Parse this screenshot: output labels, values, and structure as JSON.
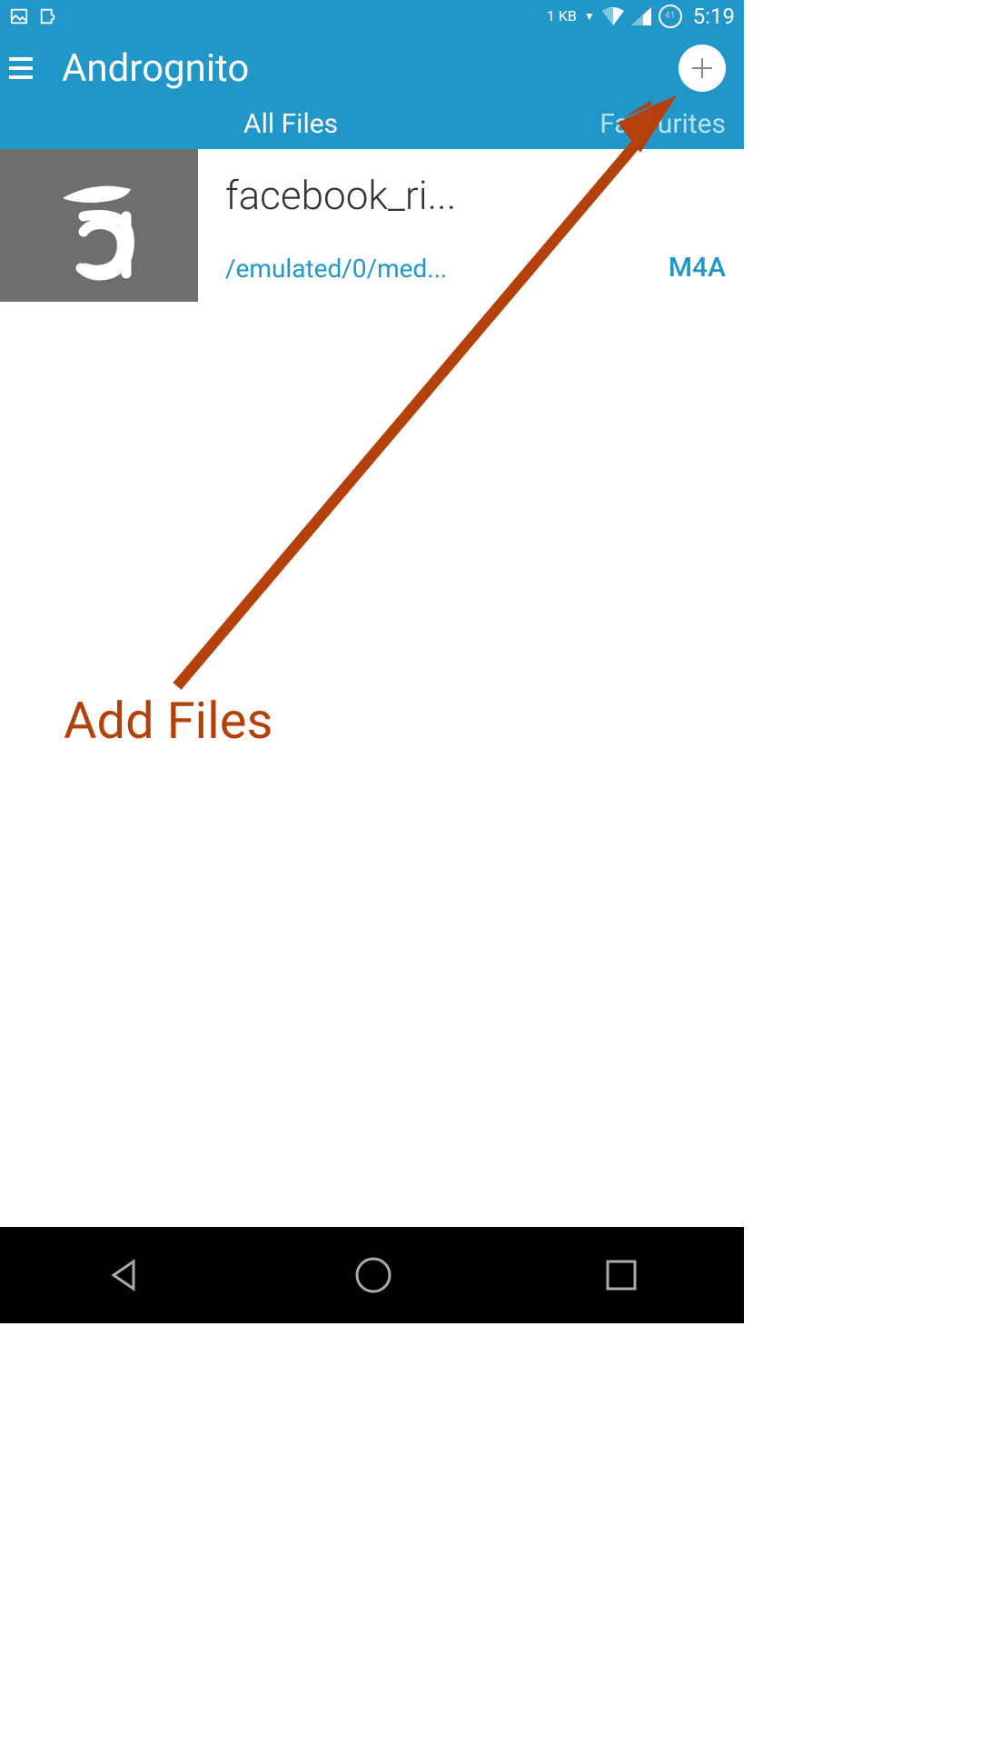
{
  "status": {
    "data_rate": "1 KB",
    "battery": "41",
    "time": "5:19"
  },
  "header": {
    "title": "Andrognito"
  },
  "tabs": {
    "active": "All Files",
    "secondary": "Favourites"
  },
  "file": {
    "name": "facebook_ri...",
    "path": "/emulated/0/med...",
    "ext": "M4A"
  },
  "annotation": {
    "label": "Add Files"
  }
}
